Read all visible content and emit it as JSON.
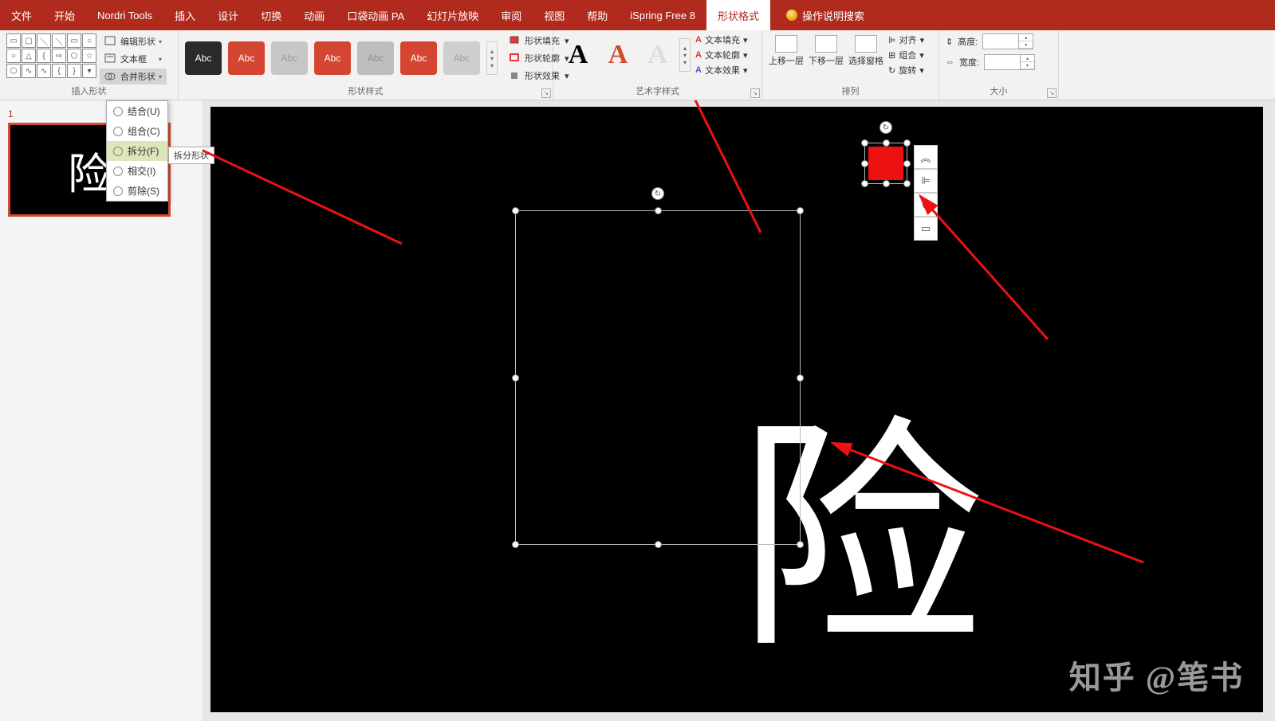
{
  "tabs": {
    "file": "文件",
    "home": "开始",
    "nordri": "Nordri Tools",
    "insert": "插入",
    "design": "设计",
    "transition": "切换",
    "animation": "动画",
    "pocket": "口袋动画 PA",
    "slideshow": "幻灯片放映",
    "review": "审阅",
    "view": "视图",
    "help": "帮助",
    "ispring": "iSpring Free 8",
    "format": "形状格式",
    "search": "操作说明搜索"
  },
  "groups": {
    "insert_shape": "插入形状",
    "shape_styles": "形状样式",
    "wordart": "艺术字样式",
    "arrange": "排列",
    "size": "大小"
  },
  "controls": {
    "edit_shape": "编辑形状",
    "text_box": "文本框",
    "merge_shapes": "合并形状",
    "shape_fill": "形状填充",
    "shape_outline": "形状轮廓",
    "shape_effects": "形状效果",
    "text_fill": "文本填充",
    "text_outline": "文本轮廓",
    "text_effects": "文本效果",
    "bring_fwd": "上移一层",
    "send_back": "下移一层",
    "sel_pane": "选择窗格",
    "align": "对齐",
    "group": "组合",
    "rotate": "旋转",
    "height": "高度:",
    "width": "宽度:",
    "abc": "Abc"
  },
  "merge_menu": {
    "union": "结合(U)",
    "combine": "组合(C)",
    "fragment": "拆分(F)",
    "intersect": "相交(I)",
    "subtract": "剪除(S)"
  },
  "tooltip": "拆分形状",
  "thumb": {
    "num": "1",
    "char": "险"
  },
  "slide": {
    "char": "险"
  },
  "watermark": "知乎 @笔书"
}
